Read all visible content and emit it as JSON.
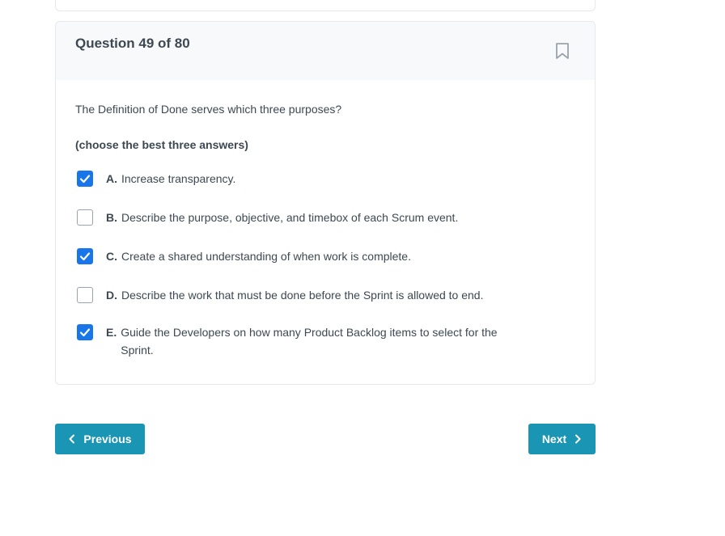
{
  "question": {
    "title": "Question 49 of 80",
    "prompt": "The Definition of Done serves which three purposes?",
    "instruction": "(choose the best three answers)",
    "options": [
      {
        "letter": "A.",
        "text": "Increase transparency.",
        "checked": true
      },
      {
        "letter": "B.",
        "text": "Describe the purpose, objective, and timebox of each Scrum event.",
        "checked": false
      },
      {
        "letter": "C.",
        "text": "Create a shared understanding of when work is complete.",
        "checked": true
      },
      {
        "letter": "D.",
        "text": "Describe the work that must be done before the Sprint is allowed to end.",
        "checked": false
      },
      {
        "letter": "E.",
        "text": "Guide the Developers on how many Product Backlog items to select for the Sprint.",
        "checked": true
      }
    ]
  },
  "navigation": {
    "previous_label": "Previous",
    "next_label": "Next"
  },
  "icons": {
    "bookmark": "bookmark-icon",
    "checkmark": "checkmark-icon",
    "chevron_left": "chevron-left-icon",
    "chevron_right": "chevron-right-icon"
  },
  "colors": {
    "accent": "#1a95b4",
    "checkbox_checked": "#1976e8",
    "text": "#3d4852",
    "header_bg": "#f8f9fa"
  }
}
